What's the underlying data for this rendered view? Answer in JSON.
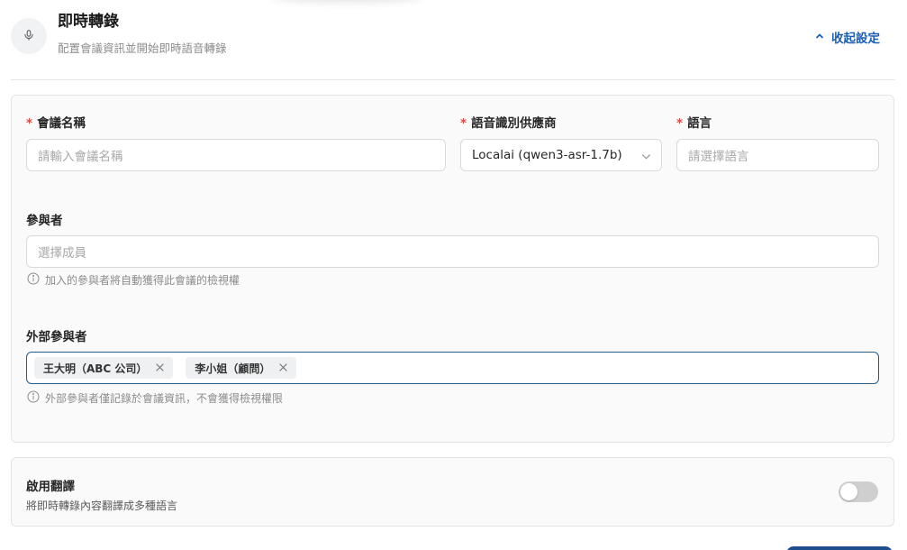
{
  "header": {
    "title": "即時轉錄",
    "subtitle": "配置會議資訊並開始即時語音轉錄",
    "collapse_label": "收起設定"
  },
  "form": {
    "meeting_name": {
      "label": "會議名稱",
      "placeholder": "請輸入會議名稱",
      "value": ""
    },
    "provider": {
      "label": "語音識別供應商",
      "value": "Localai (qwen3-asr-1.7b)"
    },
    "language": {
      "label": "語言",
      "placeholder": "請選擇語言"
    },
    "participants": {
      "label": "參與者",
      "placeholder": "選擇成員",
      "hint": "加入的參與者將自動獲得此會議的檢視權"
    },
    "external_participants": {
      "label": "外部參與者",
      "tags": [
        "王大明（ABC 公司）",
        "李小姐（顧問）"
      ],
      "hint": "外部參與者僅記錄於會議資訊，不會獲得檢視權限"
    },
    "required_mark": "*"
  },
  "translation": {
    "title": "啟用翻譯",
    "description": "將即時轉錄內容翻譯成多種語言",
    "enabled": false
  },
  "colors": {
    "accent": "#1a5fb4",
    "required": "#e5483e",
    "focus_border": "#1f5d8f"
  }
}
